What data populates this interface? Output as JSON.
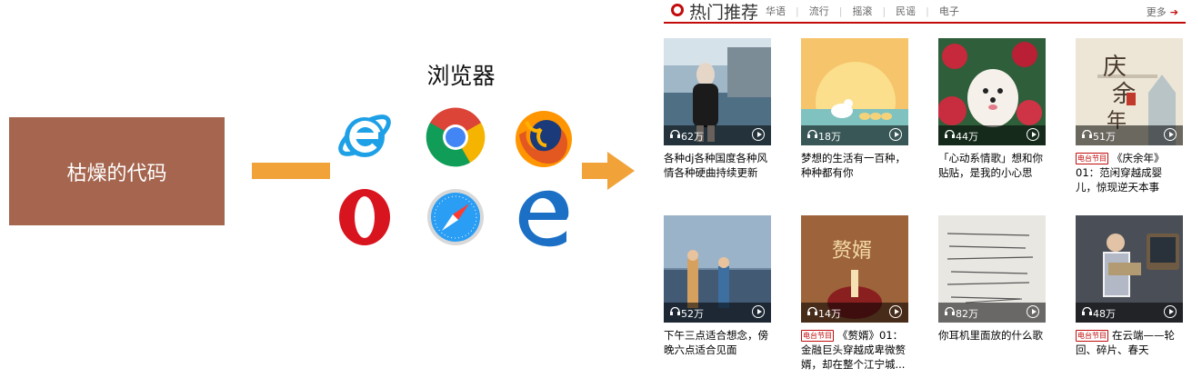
{
  "left": {
    "code_label": "枯燥的代码",
    "browser_title": "浏览器",
    "browsers": [
      "ie-icon",
      "chrome-icon",
      "firefox-icon",
      "opera-icon",
      "safari-icon",
      "edge-icon"
    ]
  },
  "panel": {
    "title": "热门推荐",
    "tabs": [
      "华语",
      "流行",
      "摇滚",
      "民谣",
      "电子"
    ],
    "more": "更多",
    "cards": [
      {
        "count": "62万",
        "desc": "各种dj各种国度各种风情各种硬曲持续更新",
        "tag": ""
      },
      {
        "count": "18万",
        "desc": "梦想的生活有一百种，种种都有你",
        "tag": ""
      },
      {
        "count": "44万",
        "desc": "「心动系情歌」想和你贴贴，是我的小心思",
        "tag": ""
      },
      {
        "count": "51万",
        "desc": "《庆余年》01：范闲穿越成婴儿，惊现逆天本事",
        "tag": "电台节目"
      },
      {
        "count": "52万",
        "desc": "下午三点适合想念，傍晚六点适合见面",
        "tag": ""
      },
      {
        "count": "14万",
        "desc": "《赘婿》01：金融巨头穿越成卑微赘婿，却在整个江宁城...",
        "tag": "电台节目"
      },
      {
        "count": "82万",
        "desc": "你耳机里面放的什么歌",
        "tag": ""
      },
      {
        "count": "48万",
        "desc": "在云端——轮回、碎片、春天",
        "tag": "电台节目"
      }
    ]
  },
  "colors": {
    "brand_red": "#c20c0c",
    "arrow": "#f1a33a",
    "code_box": "#a5654e"
  }
}
